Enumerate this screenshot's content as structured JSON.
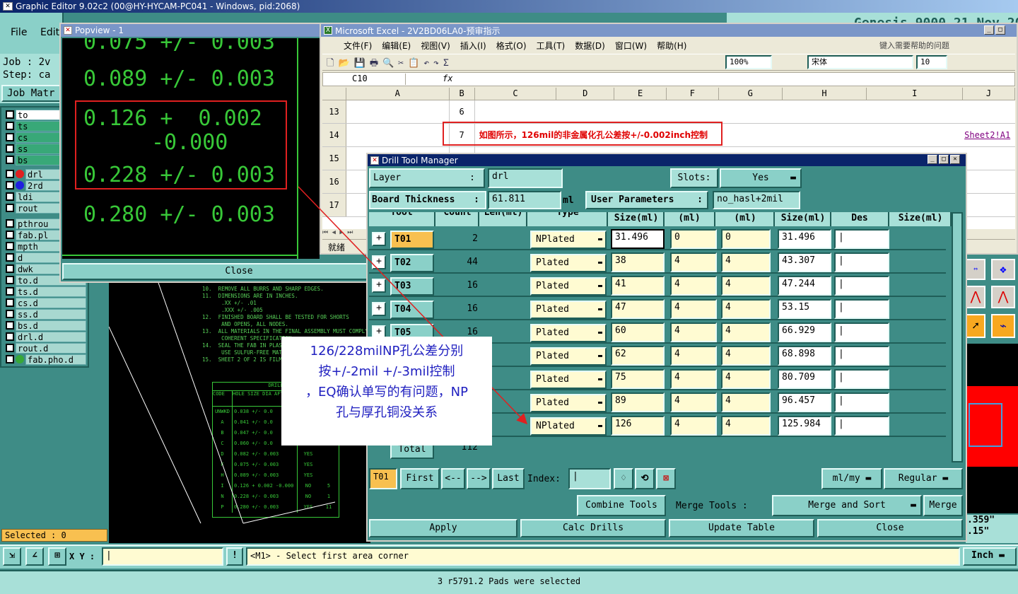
{
  "ge": {
    "title": "Graphic Editor 9.02c2 (00@HY-HYCAM-PC041 - Windows, pid:2068)",
    "menu": [
      "File",
      "Edit"
    ],
    "job_label": "Job : 2v",
    "step_label": "Step: ca",
    "job_matrix": "Job Matr",
    "right_header": "Genesis 9000 21 Nov 2014",
    "layers": [
      {
        "name": "to",
        "color": "#ffffff",
        "dot": ""
      },
      {
        "name": "ts",
        "color": "#38a878",
        "dot": ""
      },
      {
        "name": "cs",
        "color": "#38a878",
        "dot": ""
      },
      {
        "name": "ss",
        "color": "#38a878",
        "dot": ""
      },
      {
        "name": "bs",
        "color": "#38a878",
        "dot": ""
      },
      {
        "name": "drl",
        "color": "#a8d8d0",
        "dot": "#e02020"
      },
      {
        "name": "2rd",
        "color": "#a8d8d0",
        "dot": "#2020e0"
      },
      {
        "name": "ldi",
        "color": "#a8d8d0",
        "dot": ""
      },
      {
        "name": "rout",
        "color": "#a8d8d0",
        "dot": ""
      },
      {
        "name": "pthrou",
        "color": "#a8d8d0",
        "dot": ""
      },
      {
        "name": "fab.pl",
        "color": "#a8d8d0",
        "dot": ""
      },
      {
        "name": "mpth",
        "color": "#a8d8d0",
        "dot": ""
      },
      {
        "name": "d",
        "color": "#a8d8d0",
        "dot": ""
      },
      {
        "name": "dwk",
        "color": "#a8d8d0",
        "dot": ""
      },
      {
        "name": "to.d",
        "color": "#a8d8d0",
        "dot": ""
      },
      {
        "name": "ts.d",
        "color": "#a8d8d0",
        "dot": ""
      },
      {
        "name": "cs.d",
        "color": "#a8d8d0",
        "dot": ""
      },
      {
        "name": "ss.d",
        "color": "#a8d8d0",
        "dot": ""
      },
      {
        "name": "bs.d",
        "color": "#a8d8d0",
        "dot": ""
      },
      {
        "name": "drl.d",
        "color": "#a8d8d0",
        "dot": ""
      },
      {
        "name": "rout.d",
        "color": "#a8d8d0",
        "dot": ""
      },
      {
        "name": "fab.pho.d",
        "color": "#a8d8d0",
        "dot": "#38a838"
      }
    ],
    "selected": "Selected : 0",
    "xy_label": "X Y :",
    "status_prompt": "<M1> - Select first area corner",
    "unit": "Inch",
    "bottom_status": "3 r5791.2 Pads were selected",
    "coord_readout_1": ".359\"",
    "coord_readout_2": ".15\""
  },
  "popview": {
    "title": "Popview - 1",
    "lines": [
      "0.075 +/- 0.003",
      "0.089 +/- 0.003",
      "0.126 +  0.002",
      "-0.000",
      "0.228 +/- 0.003",
      "0.280 +/- 0.003"
    ],
    "close": "Close"
  },
  "notes": {
    "lines": [
      "10.  REMOVE ALL BURRS AND SHARP EDGES.",
      "11.  DIMENSIONS ARE IN INCHES.",
      "      .XX +/- .01",
      "      .XXX +/- .005",
      "12.  FINISHED BOARD SHALL BE TESTED FOR SHORTS",
      "      AND OPENS, ALL NODES.",
      "13.  ALL MATERIALS IN THE FINAL ASSEMBLY MUST COMPLY",
      "      COHERENT SPECIFICATION",
      "14.  SEAL THE FAB IN PLASTI",
      "      USE SULFUR-FREE MATER",
      "15.  SHEET 2 OF 2 IS FILM M"
    ],
    "drill_title": "DRILL",
    "drill_headers": [
      "CODE",
      "HOLE SIZE DIA AFTER PLATED"
    ],
    "drill_rows": [
      [
        "UNWKD",
        "0.038 +/- 0.0"
      ],
      [
        "A",
        "0.041 +/- 0.0"
      ],
      [
        "B",
        "0.047 +/- 0.0"
      ],
      [
        "C",
        "0.060 +/- 0.0"
      ],
      [
        "D",
        "0.082 +/- 0.003"
      ],
      [
        "F",
        "0.075 +/- 0.003"
      ],
      [
        "H",
        "0.089 +/- 0.003"
      ],
      [
        "I",
        "0.126 + 0.002 -0.000"
      ],
      [
        "N",
        "0.228 +/- 0.003"
      ],
      [
        "P",
        "0.280 +/- 0.003"
      ]
    ],
    "drill_plated": [
      "",
      "",
      "",
      "YES",
      "YES",
      "YES",
      "YES",
      "NO",
      "NO",
      "YES"
    ],
    "drill_counts": [
      "",
      "",
      "",
      "",
      "",
      "",
      "",
      "5",
      "1",
      "11"
    ]
  },
  "excel": {
    "title": "Microsoft Excel - 2V2BD06LA0-预审指示",
    "menu": [
      "文件(F)",
      "编辑(E)",
      "视图(V)",
      "插入(I)",
      "格式(O)",
      "工具(T)",
      "数据(D)",
      "窗口(W)",
      "帮助(H)"
    ],
    "help_placeholder": "键入需要帮助的问题",
    "zoom": "100%",
    "font": "宋体",
    "font_size": "10",
    "name_box": "C10",
    "fx": "fx",
    "columns": [
      "A",
      "B",
      "C",
      "D",
      "E",
      "F",
      "G",
      "H",
      "I",
      "J"
    ],
    "rows": [
      {
        "num": "13",
        "b": "6",
        "c": "",
        "j": ""
      },
      {
        "num": "14",
        "b": "7",
        "c": "如图所示，126mil的非金属化孔公差按+/-0.002inch控制",
        "j": "Sheet2!A1"
      },
      {
        "num": "15",
        "b": "",
        "c": "",
        "j": ""
      },
      {
        "num": "16",
        "b": "",
        "c": "",
        "j": ""
      },
      {
        "num": "17",
        "b": "",
        "c": "",
        "j": ""
      }
    ],
    "status": "就绪"
  },
  "dtm": {
    "title": "Drill Tool Manager",
    "layer_label": "Layer",
    "layer_value": "drl",
    "slots_label": "Slots:",
    "slots_value": "Yes",
    "board_thickness_label": "Board Thickness",
    "board_thickness_value": "61.811",
    "board_thickness_unit": "ml",
    "user_params_label": "User Parameters",
    "user_params_value": "no_hasl+2mil",
    "headers": [
      "Tool",
      "Count",
      "Len(ml)",
      "Type",
      "Size(ml)",
      "(ml)",
      "(ml)",
      "Size(ml)",
      "Des",
      "Size(ml)"
    ],
    "rows": [
      {
        "tool": "T01",
        "count": "2",
        "type": "NPlated",
        "size": "31.496",
        "p": "0",
        "m": "0",
        "fin": "31.496"
      },
      {
        "tool": "T02",
        "count": "44",
        "type": "Plated",
        "size": "38",
        "p": "4",
        "m": "4",
        "fin": "43.307"
      },
      {
        "tool": "T03",
        "count": "16",
        "type": "Plated",
        "size": "41",
        "p": "4",
        "m": "4",
        "fin": "47.244"
      },
      {
        "tool": "T04",
        "count": "16",
        "type": "Plated",
        "size": "47",
        "p": "4",
        "m": "4",
        "fin": "53.15"
      },
      {
        "tool": "T05",
        "count": "16",
        "type": "Plated",
        "size": "60",
        "p": "4",
        "m": "4",
        "fin": "66.929"
      },
      {
        "tool": "",
        "count": "",
        "type": "Plated",
        "size": "62",
        "p": "4",
        "m": "4",
        "fin": "68.898"
      },
      {
        "tool": "",
        "count": "",
        "type": "Plated",
        "size": "75",
        "p": "4",
        "m": "4",
        "fin": "80.709"
      },
      {
        "tool": "",
        "count": "",
        "type": "Plated",
        "size": "89",
        "p": "4",
        "m": "4",
        "fin": "96.457"
      },
      {
        "tool": "",
        "count": "",
        "type": "NPlated",
        "size": "126",
        "p": "4",
        "m": "4",
        "fin": "125.984"
      }
    ],
    "total_label": "Total",
    "total_value": "112",
    "nav_current": "T01",
    "first": "First",
    "prev": "<--",
    "next": "-->",
    "last": "Last",
    "index_label": "Index:",
    "units": "ml/my",
    "mode": "Regular",
    "combine_tools": "Combine Tools",
    "merge_tools_label": "Merge Tools :",
    "merge_sort": "Merge and Sort",
    "merge": "Merge",
    "apply": "Apply",
    "calc_drills": "Calc Drills",
    "update_table": "Update Table",
    "close": "Close"
  },
  "annotation": {
    "lines": [
      "126/228milNP孔公差分别",
      "按+/-2mil +/-3mil控制",
      "，EQ确认单写的有问题，NP",
      "孔与厚孔铜没关系"
    ]
  }
}
